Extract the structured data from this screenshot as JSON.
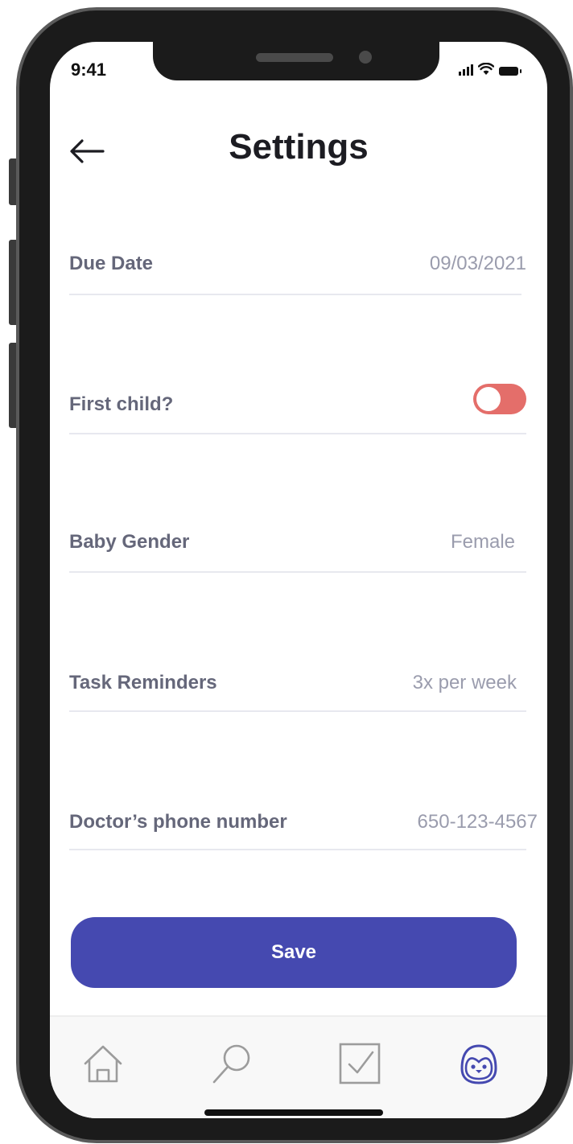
{
  "status_bar": {
    "time": "9:41"
  },
  "header": {
    "title": "Settings",
    "back_icon": "arrow-left-icon"
  },
  "settings": [
    {
      "label": "Due Date",
      "value": "09/03/2021"
    },
    {
      "label": "First child?",
      "toggle": false,
      "toggle_color": "#e46e6a"
    },
    {
      "label": "Baby Gender",
      "value": "Female"
    },
    {
      "label": "Task Reminders",
      "value": "3x per week"
    },
    {
      "label": "Doctor’s phone number",
      "value": "650-123-4567"
    }
  ],
  "save_button": {
    "label": "Save",
    "color": "#4549b0"
  },
  "tabbar": {
    "tabs": [
      {
        "name": "home",
        "icon": "home-icon"
      },
      {
        "name": "search",
        "icon": "search-icon"
      },
      {
        "name": "tasks",
        "icon": "checkbox-icon"
      },
      {
        "name": "profile",
        "icon": "penguin-icon",
        "active": true
      }
    ],
    "active_color": "#4549b0"
  }
}
